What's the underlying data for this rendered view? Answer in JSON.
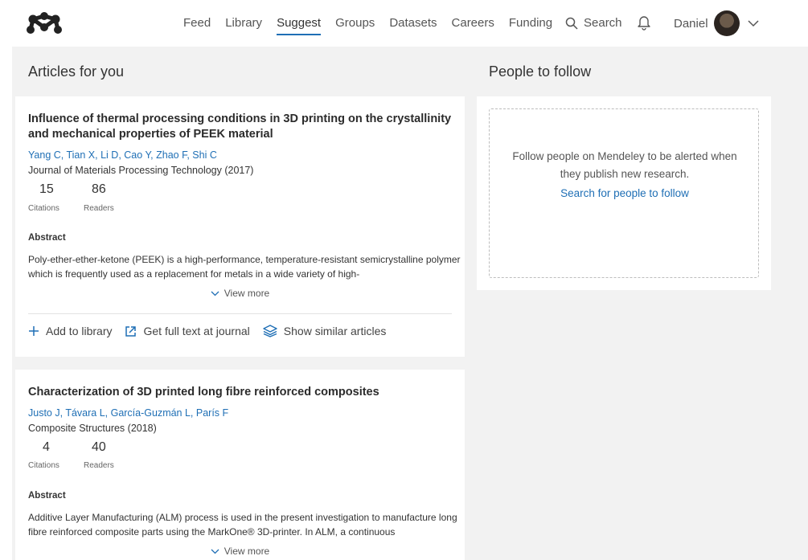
{
  "nav": {
    "items": [
      {
        "label": "Feed",
        "active": false
      },
      {
        "label": "Library",
        "active": false
      },
      {
        "label": "Suggest",
        "active": true
      },
      {
        "label": "Groups",
        "active": false
      },
      {
        "label": "Datasets",
        "active": false
      },
      {
        "label": "Careers",
        "active": false
      },
      {
        "label": "Funding",
        "active": false
      }
    ],
    "search_label": "Search",
    "user_name": "Daniel"
  },
  "articles_section": {
    "title": "Articles for you"
  },
  "people_section": {
    "title": "People to follow",
    "message": "Follow people on Mendeley to be alerted when they publish new research.",
    "link": "Search for people to follow"
  },
  "articles": [
    {
      "title": "Influence of thermal processing conditions in 3D printing on the crystallinity and mechanical properties of PEEK material",
      "authors": "Yang C, Tian X, Li D, Cao Y, Zhao F, Shi C",
      "journal": "Journal of Materials Processing Technology (2017)",
      "citations": "15",
      "citations_label": "Citations",
      "readers": "86",
      "readers_label": "Readers",
      "abstract_label": "Abstract",
      "abstract": "Poly-ether-ether-ketone (PEEK) is a high-performance, temperature-resistant semicrystalline polymer which is frequently used as a replacement for metals in a wide variety of high-",
      "view_more": "View more",
      "actions": {
        "add": "Add to library",
        "full_text": "Get full text at journal",
        "similar": "Show similar articles"
      }
    },
    {
      "title": "Characterization of 3D printed long fibre reinforced composites",
      "authors": "Justo J, Távara L, García-Guzmán L, París F",
      "journal": "Composite Structures (2018)",
      "citations": "4",
      "citations_label": "Citations",
      "readers": "40",
      "readers_label": "Readers",
      "abstract_label": "Abstract",
      "abstract": "Additive Layer Manufacturing (ALM) process is used in the present investigation to manufacture long fibre reinforced composite parts using the MarkOne® 3D-printer. In ALM, a continuous",
      "view_more": "View more"
    }
  ],
  "colors": {
    "accent": "#1f6fb5",
    "background": "#f2f2f2"
  }
}
